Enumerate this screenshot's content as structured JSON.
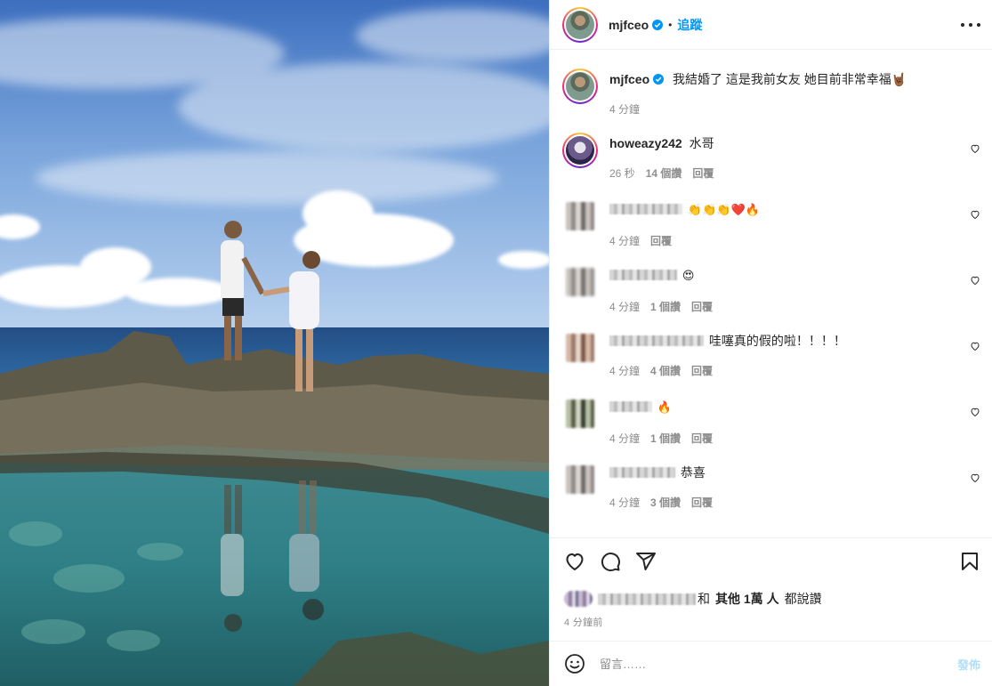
{
  "post": {
    "author": "mjfceo",
    "follow_label": "追蹤",
    "separator": "•",
    "caption": "我結婚了 這是我前女友 她目前非常幸福🤘🏾",
    "caption_time": "4 分鐘"
  },
  "comments": [
    {
      "user": "howeazy242",
      "text": "水哥",
      "time": "26 秒",
      "likes": "14 個讚",
      "reply": "回覆"
    },
    {
      "user": "",
      "text": "👏👏👏❤️🔥",
      "time": "4 分鐘",
      "likes": "",
      "reply": "回覆"
    },
    {
      "user": "",
      "text": "😍",
      "time": "4 分鐘",
      "likes": "1 個讚",
      "reply": "回覆"
    },
    {
      "user": "",
      "text": "哇噻真的假的啦！！！！",
      "time": "4 分鐘",
      "likes": "4 個讚",
      "reply": "回覆"
    },
    {
      "user": "",
      "text": "🔥",
      "time": "4 分鐘",
      "likes": "1 個讚",
      "reply": "回覆"
    },
    {
      "user": "",
      "text": "恭喜",
      "time": "4 分鐘",
      "likes": "3 個讚",
      "reply": "回覆"
    }
  ],
  "likes_summary": {
    "prefix": "和",
    "others": "其他 1萬 人",
    "suffix": "都說讚"
  },
  "post_time": "4 分鐘前",
  "comment_input": {
    "placeholder": "留言……",
    "post_label": "發佈"
  },
  "icons": {
    "like": "heart-icon",
    "comment": "comment-icon",
    "share": "paper-plane-icon",
    "save": "bookmark-icon",
    "more": "more-options-icon",
    "emoji": "emoji-icon",
    "verified": "verified-badge-icon"
  },
  "colors": {
    "accent": "#0095f6",
    "post_button_disabled": "#b2dffc",
    "meta_text": "#8e8e8e"
  }
}
